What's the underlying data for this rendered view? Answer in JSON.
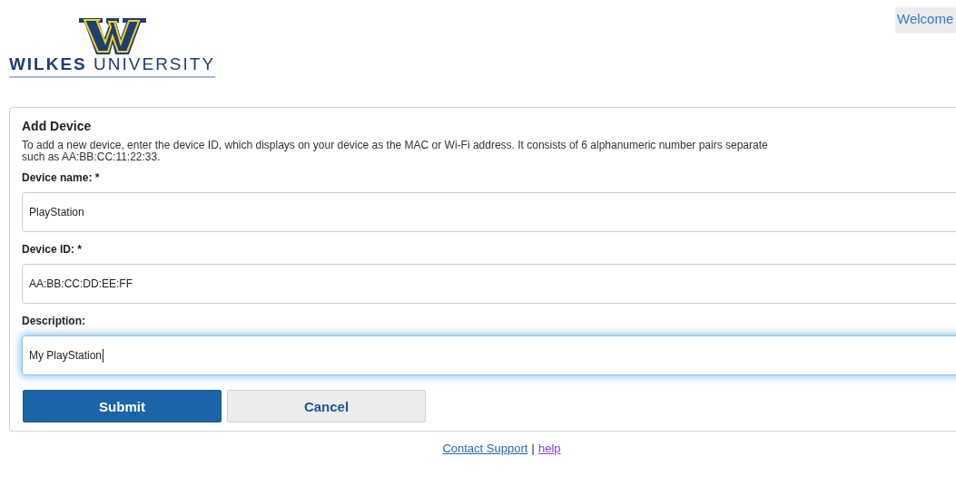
{
  "header": {
    "logo_text": "**WILKES** UNIVERSITY",
    "welcome": "Welcome"
  },
  "form": {
    "title": "Add Device",
    "intro": "To add a new device, enter the device ID, which displays on your device as the MAC or Wi-Fi address. It consists of 6 alphanumeric number pairs separate\nsuch as AA:BB:CC:11:22:33.",
    "fields": [
      {
        "label": "Device name: *",
        "value": "PlayStation",
        "focused": false
      },
      {
        "label": "Device ID: *",
        "value": "AA:BB:CC:DD:EE:FF",
        "focused": false
      },
      {
        "label": "Description:",
        "value": "My PlayStation",
        "focused": true
      }
    ],
    "buttons": [
      {
        "label": "Submit",
        "kind": "primary"
      },
      {
        "label": "Cancel",
        "kind": "secondary"
      }
    ]
  },
  "footer": {
    "links": [
      {
        "label": "Contact Support",
        "visited": false
      },
      {
        "label": "help",
        "visited": true
      }
    ],
    "separator": "|"
  }
}
